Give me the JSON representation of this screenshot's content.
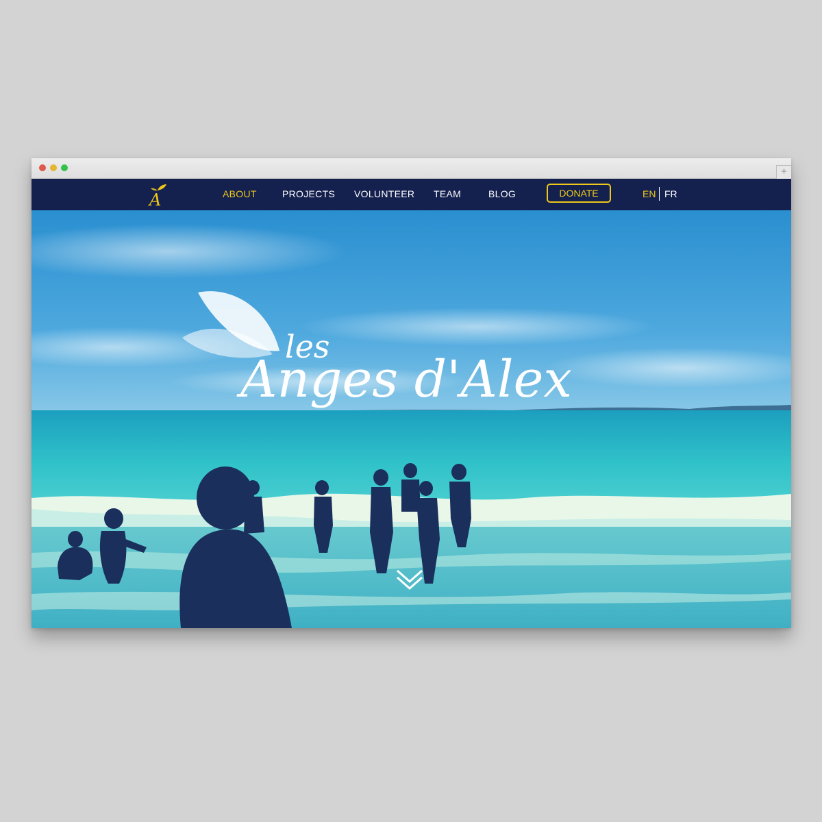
{
  "brand": {
    "logo_letter": "A",
    "tagline_small": "les",
    "tagline_main": "Anges d'Alex"
  },
  "nav": {
    "about": "ABOUT",
    "projects": "PROJECTS",
    "volunteer": "VOLUNTEER",
    "team": "TEAM",
    "blog": "BLOG",
    "donate": "DONATE",
    "lang_en": "EN",
    "lang_fr": "FR"
  },
  "browser": {
    "new_tab": "+"
  },
  "colors": {
    "nav_bg": "#14214f",
    "accent_yellow": "#efc81a",
    "nav_text": "#ffffff",
    "sky": "#3fa0d8",
    "sea": "#2fc1c9"
  },
  "icons": {
    "scroll": "double-chevron-down-icon",
    "logo_wing": "angel-wing-icon"
  }
}
